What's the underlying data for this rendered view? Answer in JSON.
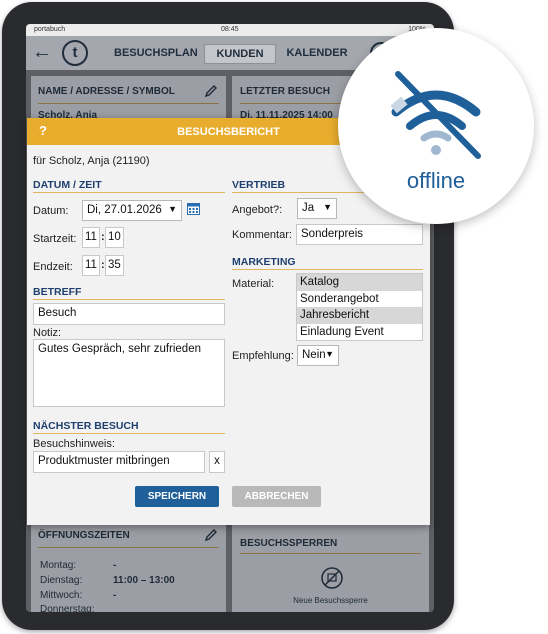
{
  "statusbar": {
    "carrier": "portabuch",
    "time": "08:45",
    "battery": "100%"
  },
  "nav": {
    "back": "←",
    "logo": "t",
    "tabs": [
      "BESUCHSPLAN",
      "KUNDEN",
      "KALENDER"
    ],
    "help": "?"
  },
  "background": {
    "panel_name": "NAME / ADRESSE / SYMBOL",
    "panel_last": "LETZTER BESUCH",
    "name_value": "Scholz, Anja",
    "last_value": "Di, 11.11.2025 14:00",
    "panel_hours": "ÖFFNUNGSZEITEN",
    "hours": [
      {
        "day": "Montag:",
        "time": "-"
      },
      {
        "day": "Dienstag:",
        "time": "11:00 – 13:00"
      },
      {
        "day": "Mittwoch:",
        "time": "-"
      },
      {
        "day": "Donnerstag:",
        "time": ""
      }
    ],
    "panel_blocks": "BESUCHSSPERREN",
    "new_block": "Neue Besuchssperre"
  },
  "dialog": {
    "help": "?",
    "title": "BESUCHSBERICHT",
    "customer": "für Scholz, Anja (21190)",
    "datetime": {
      "heading": "DATUM / ZEIT",
      "date_label": "Datum:",
      "date_value": "Di, 27.01.2026",
      "start_label": "Startzeit:",
      "start_h": "11",
      "start_m": "10",
      "end_label": "Endzeit:",
      "end_h": "11",
      "end_m": "35",
      "colon": ":"
    },
    "subject": {
      "heading": "BETREFF",
      "value": "Besuch",
      "note_label": "Notiz:",
      "note_value": "Gutes Gespräch, sehr zufrieden"
    },
    "next_visit": {
      "heading": "NÄCHSTER BESUCH",
      "hint_label": "Besuchshinweis:",
      "hint_value": "Produktmuster mitbringen",
      "clear": "x"
    },
    "sales": {
      "heading": "VERTRIEB",
      "offer_label": "Angebot?:",
      "offer_value": "Ja",
      "comment_label": "Kommentar:",
      "comment_value": "Sonderpreis"
    },
    "marketing": {
      "heading": "MARKETING",
      "material_label": "Material:",
      "materials": [
        {
          "label": "Katalog",
          "selected": true
        },
        {
          "label": "Sonderangebot",
          "selected": false
        },
        {
          "label": "Jahresbericht",
          "selected": true
        },
        {
          "label": "Einladung Event",
          "selected": false
        }
      ],
      "recommend_label": "Empfehlung:",
      "recommend_value": "Nein"
    },
    "save": "SPEICHERN",
    "cancel": "ABBRECHEN"
  },
  "badge": {
    "text": "offline"
  },
  "colors": {
    "accent": "#e9ad2e",
    "primary": "#1f5f9a",
    "heading": "#1f3f6e"
  }
}
